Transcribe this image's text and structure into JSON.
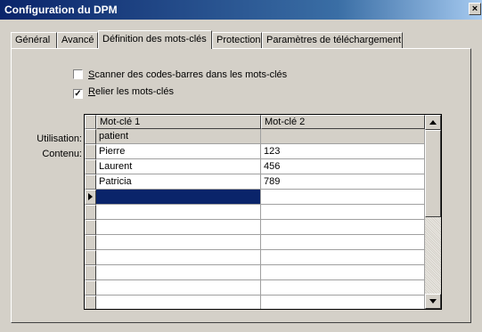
{
  "window": {
    "title": "Configuration du DPM",
    "close_glyph": "×"
  },
  "tabs": [
    {
      "label": "Général",
      "active": false
    },
    {
      "label": "Avancé",
      "active": false
    },
    {
      "label": "Définition des mots-clés",
      "active": true
    },
    {
      "label": "Protection",
      "active": false
    },
    {
      "label": "Paramètres de téléchargement",
      "active": false
    }
  ],
  "options": {
    "scan_barcodes": {
      "label_accel": "S",
      "label_rest": "canner des codes-barres dans les mots-clés",
      "checked": false
    },
    "link_keywords": {
      "label_accel": "R",
      "label_rest": "elier les mots-clés",
      "checked": true
    }
  },
  "row_labels": {
    "usage": "Utilisation:",
    "content": "Contenu:"
  },
  "grid": {
    "columns": [
      "Mot-clé 1",
      "Mot-clé 2"
    ],
    "usage_row": [
      "patient",
      ""
    ],
    "rows": [
      [
        "Pierre",
        "123"
      ],
      [
        "Laurent",
        "456"
      ],
      [
        "Patricia",
        "789"
      ]
    ],
    "empty_rows": 8,
    "current_row_marker": "arrow-right-icon"
  },
  "colors": {
    "title_bar": "#0a246a",
    "selection": "#0a246a",
    "face": "#d4d0c8"
  }
}
